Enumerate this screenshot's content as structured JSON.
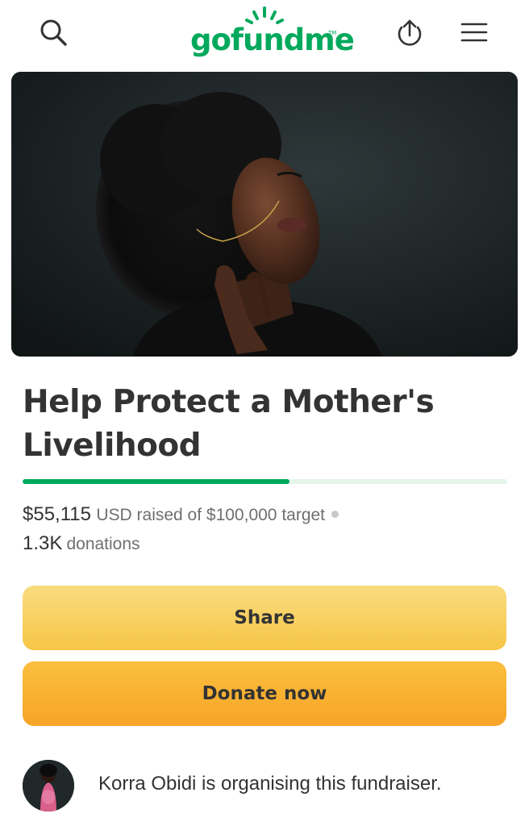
{
  "header": {
    "logo_text": "gofundme",
    "logo_tm": "TM",
    "icons": [
      "search-icon",
      "upload-icon",
      "menu-icon"
    ],
    "brand_color": "#02a95c"
  },
  "hero": {
    "image": "photo of woman in black with natural afro hair against dark backdrop"
  },
  "campaign": {
    "title": "Help Protect a Mother's Livelihood",
    "amount_raised": "$55,115",
    "raised_text": "USD raised of $100,000 target",
    "donation_count": "1.3K",
    "donations_label": "donations",
    "progress": 0.55
  },
  "buttons": {
    "share_label": "Share",
    "donate_label": "Donate now"
  },
  "organiser": {
    "text": "Korra Obidi is organising this fundraiser."
  }
}
